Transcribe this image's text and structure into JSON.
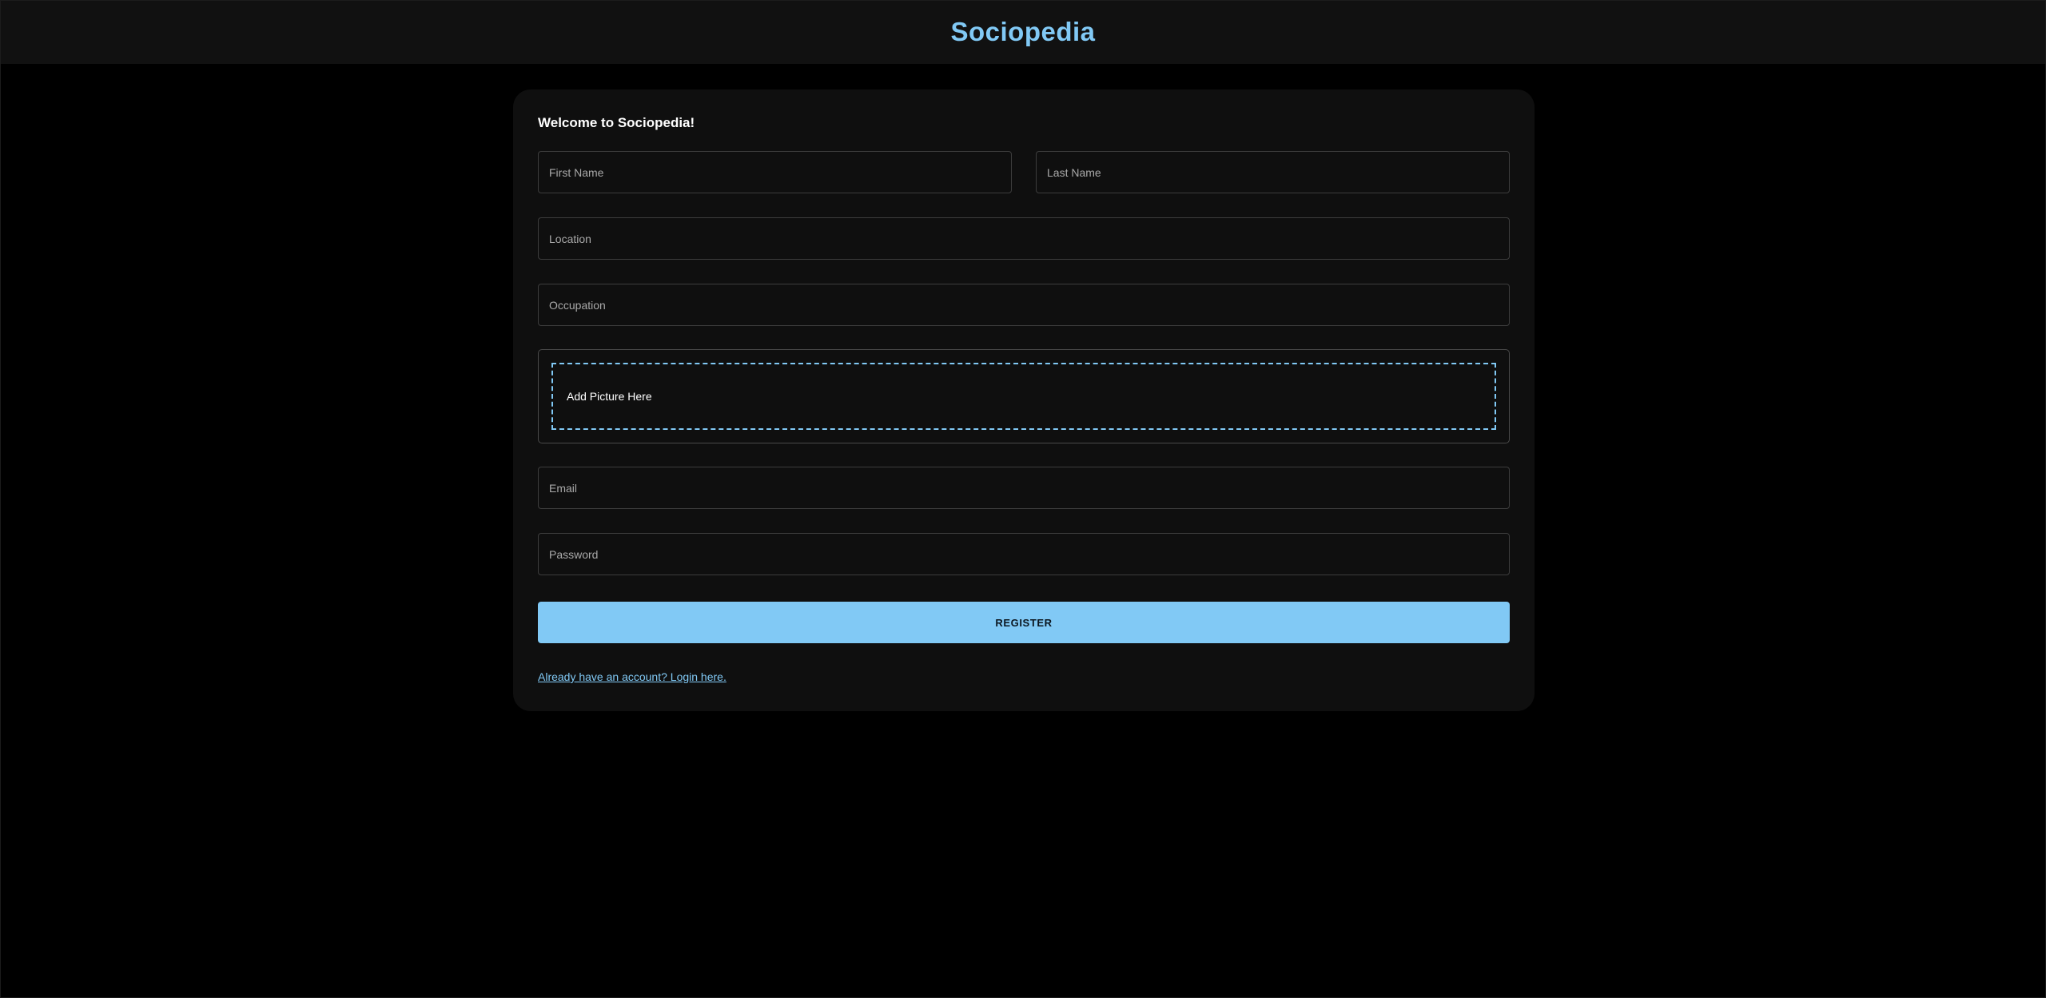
{
  "header": {
    "brand": "Sociopedia"
  },
  "form": {
    "welcome": "Welcome to Sociopedia!",
    "fields": {
      "first_name": {
        "placeholder": "First Name",
        "value": ""
      },
      "last_name": {
        "placeholder": "Last Name",
        "value": ""
      },
      "location": {
        "placeholder": "Location",
        "value": ""
      },
      "occupation": {
        "placeholder": "Occupation",
        "value": ""
      },
      "email": {
        "placeholder": "Email",
        "value": ""
      },
      "password": {
        "placeholder": "Password",
        "value": ""
      }
    },
    "picture_label": "Add Picture Here",
    "register_label": "REGISTER",
    "login_link": "Already have an account? Login here."
  },
  "colors": {
    "accent": "#81c9f5",
    "background": "#000000",
    "card": "#0f0f0f",
    "top_bar": "#111111"
  }
}
